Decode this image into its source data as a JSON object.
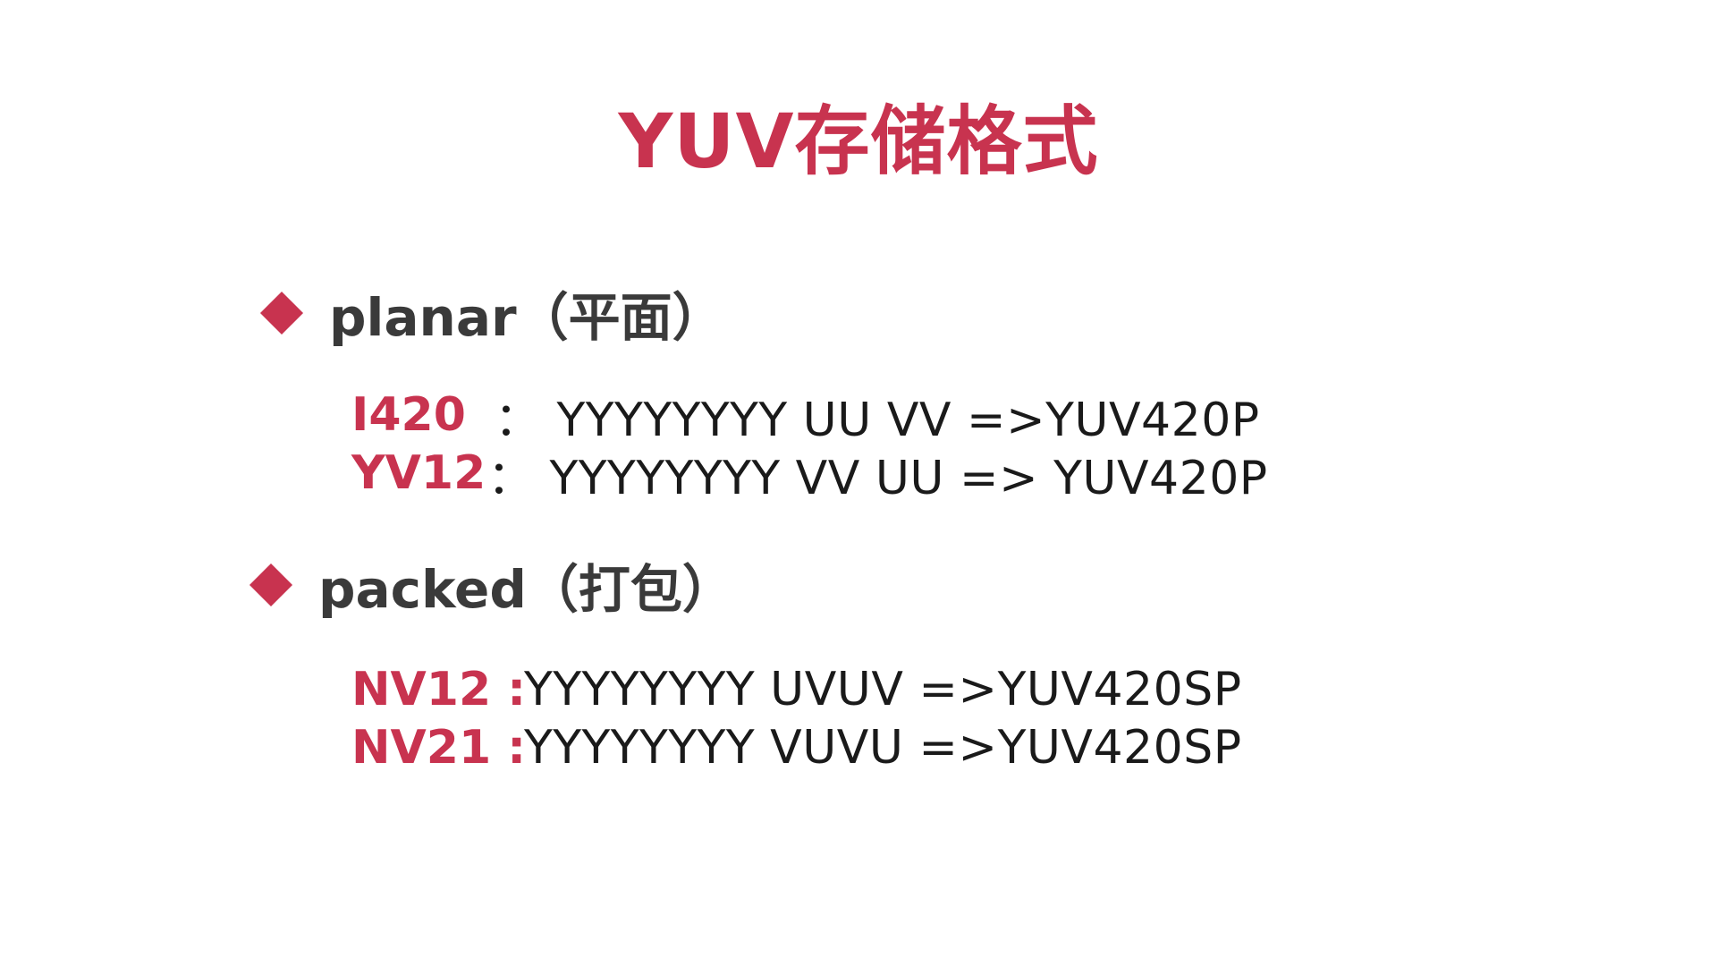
{
  "colors": {
    "accent": "#c8334f",
    "heading_text": "#3a3a3a",
    "body_text": "#1a1a1a",
    "background": "#ffffff"
  },
  "title": "YUV存储格式",
  "sections": [
    {
      "heading": "planar（平面）",
      "bullet_icon": "diamond-bullet-icon",
      "lines": [
        {
          "name": "I420",
          "value": "： YYYYYYYY UU VV =>YUV420P"
        },
        {
          "name": "YV12",
          "value": "： YYYYYYYY VV UU => YUV420P"
        }
      ]
    },
    {
      "heading": "packed（打包）",
      "bullet_icon": "diamond-bullet-icon",
      "lines": [
        {
          "name": "NV12 :",
          "value": " YYYYYYYY UVUV =>YUV420SP"
        },
        {
          "name": "NV21 :",
          "value": " YYYYYYYY VUVU =>YUV420SP"
        }
      ]
    }
  ]
}
